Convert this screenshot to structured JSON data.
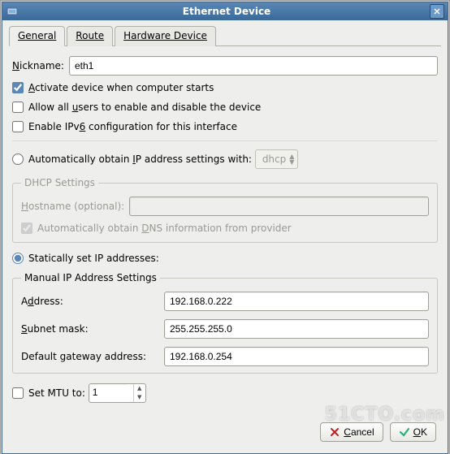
{
  "window": {
    "title": "Ethernet Device"
  },
  "tabs": {
    "general": "General",
    "route": "Route",
    "hardware": "Hardware Device"
  },
  "nickname": {
    "label_pre": "N",
    "label_post": "ickname:",
    "value": "eth1"
  },
  "activate": {
    "checked": true,
    "pre": "A",
    "post": "ctivate device when computer starts"
  },
  "allowUsers": {
    "checked": false,
    "pre": "Allow all ",
    "mid": "u",
    "post": "sers to enable and disable the device"
  },
  "ipv6": {
    "checked": false,
    "pre": "Enable IPv",
    "mid": "6",
    "post": " configuration for this interface"
  },
  "autoIP": {
    "selected": false,
    "label_pre": "Automatically obtain ",
    "label_mid": "I",
    "label_post": "P address settings with:",
    "combo": "dhcp"
  },
  "dhcp": {
    "legend": "DHCP Settings",
    "hostname": {
      "label_pre": "H",
      "label_post": "ostname (optional):",
      "value": ""
    },
    "autodns": {
      "checked": true,
      "pre": "Automatically obtain ",
      "mid": "D",
      "post": "NS information from provider"
    }
  },
  "staticIP": {
    "selected": true,
    "label": "Statically set IP addresses:"
  },
  "manual": {
    "legend": "Manual IP Address Settings",
    "address": {
      "label_pre": "A",
      "label_mid": "d",
      "label_post": "dress:",
      "value": "192.168.0.222"
    },
    "subnet": {
      "label_pre": "S",
      "label_mid": "u",
      "label_post": "bnet mask:",
      "value": "255.255.255.0"
    },
    "gateway": {
      "label": "Default gateway address:",
      "value": "192.168.0.254"
    }
  },
  "mtu": {
    "checked": false,
    "label": "Set MTU to:",
    "value": "1"
  },
  "buttons": {
    "cancel_pre": "C",
    "cancel_post": "ancel",
    "ok_pre": "O",
    "ok_post": "K"
  },
  "watermark": "51CTO.com"
}
